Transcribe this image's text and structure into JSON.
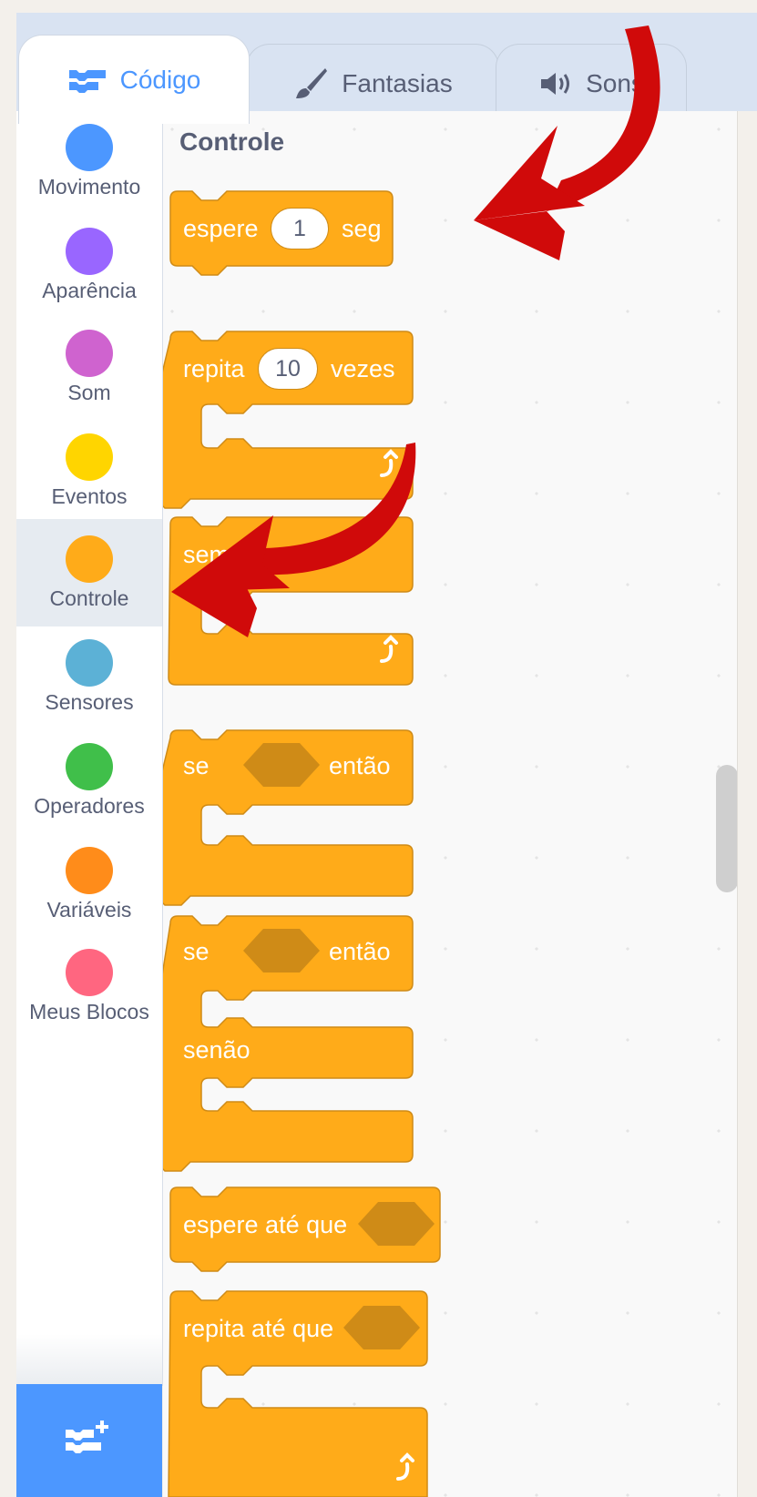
{
  "tabs": [
    {
      "label": "Código",
      "icon": "code-icon",
      "active": true
    },
    {
      "label": "Fantasias",
      "icon": "paintbrush-icon",
      "active": false
    },
    {
      "label": "Sons",
      "icon": "speaker-icon",
      "active": false
    }
  ],
  "categories": [
    {
      "label": "Movimento",
      "color": "#4c97ff",
      "selected": false
    },
    {
      "label": "Aparência",
      "color": "#9966ff",
      "selected": false
    },
    {
      "label": "Som",
      "color": "#cf63cf",
      "selected": false
    },
    {
      "label": "Eventos",
      "color": "#ffd500",
      "selected": false
    },
    {
      "label": "Controle",
      "color": "#ffab19",
      "selected": true
    },
    {
      "label": "Sensores",
      "color": "#5cb1d6",
      "selected": false
    },
    {
      "label": "Operadores",
      "color": "#40bf4a",
      "selected": false
    },
    {
      "label": "Variáveis",
      "color": "#ff8c1a",
      "selected": false
    },
    {
      "label": "Meus Blocos",
      "color": "#ff6680",
      "selected": false
    }
  ],
  "palette": {
    "title": "Controle",
    "blocks": {
      "wait": {
        "pre": "espere",
        "value": "1",
        "post": "seg"
      },
      "repeat": {
        "pre": "repita",
        "value": "10",
        "post": "vezes"
      },
      "forever": {
        "label": "sempre"
      },
      "if_then": {
        "pre": "se",
        "post": "então"
      },
      "if_else": {
        "pre": "se",
        "post": "então",
        "else": "senão"
      },
      "wait_until": {
        "label": "espere até que"
      },
      "repeat_until": {
        "label": "repita até que"
      }
    }
  },
  "extension_button": {
    "icon": "add-extension-icon"
  },
  "colors": {
    "control_block": "#ffab19",
    "control_block_border": "#cf8b17",
    "hexagon_slot": "#cf8b17",
    "accent": "#4c97ff",
    "annotation_arrow": "#d00a0a"
  }
}
